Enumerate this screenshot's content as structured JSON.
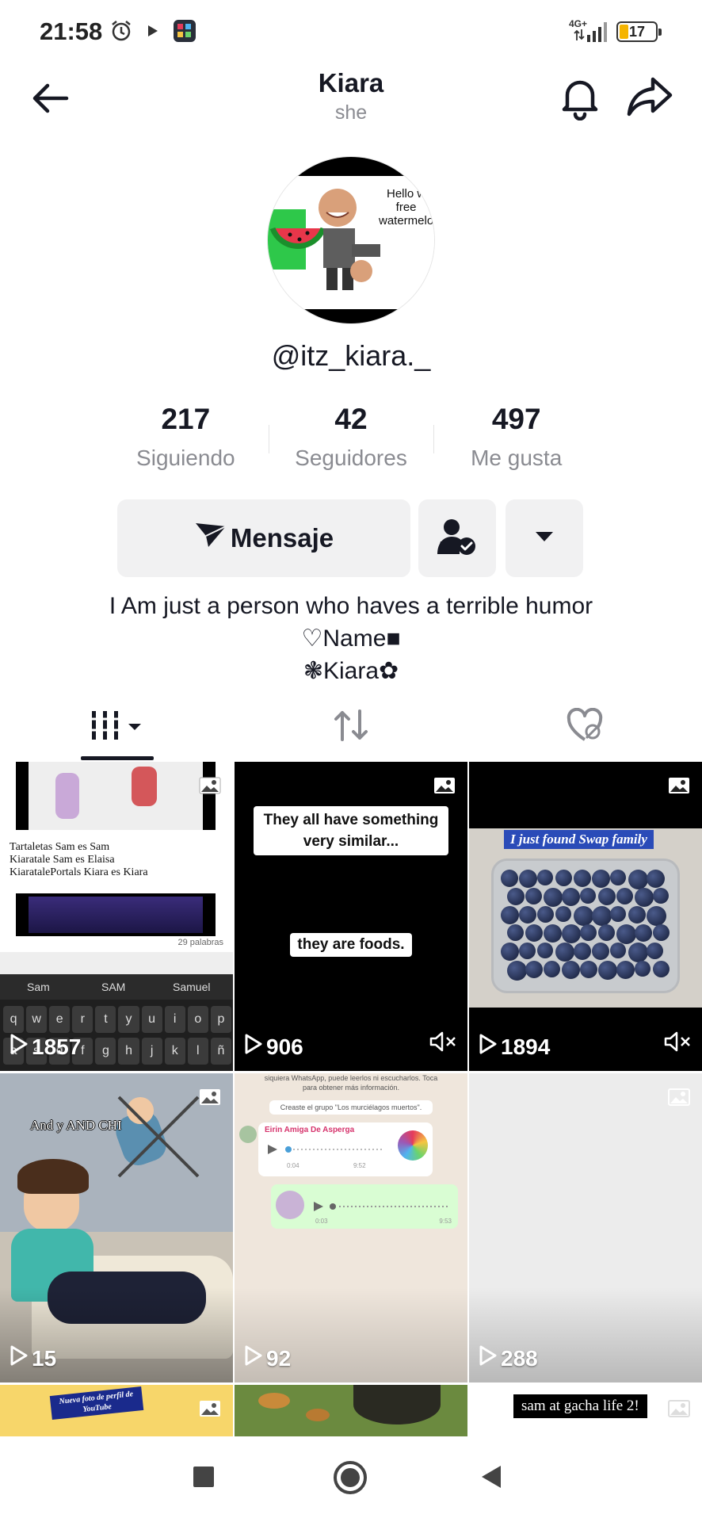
{
  "status_bar": {
    "time": "21:58",
    "network": "4G+",
    "battery": "17"
  },
  "header": {
    "name": "Kiara",
    "pronoun": "she"
  },
  "avatar": {
    "text_line1": "Hello w",
    "text_line2": "free",
    "text_line3": "watermelo"
  },
  "profile": {
    "handle": "@itz_kiara._"
  },
  "stats": [
    {
      "value": "217",
      "label": "Siguiendo"
    },
    {
      "value": "42",
      "label": "Seguidores"
    },
    {
      "value": "497",
      "label": "Me gusta"
    }
  ],
  "actions": {
    "message_label": "Mensaje"
  },
  "bio": {
    "line1": "I Am just a person who haves a terrible humor",
    "line2": "♡Name■",
    "line3": "❃Kiara✿"
  },
  "posts": [
    {
      "views": "1857",
      "doc_lines": [
        "Tartaletas Sam es Sam",
        "Kiaratale Sam es Elaisa",
        "KiaratalePortals Kiara es Kiara"
      ],
      "word_count": "29 palabras",
      "suggestions": [
        "Sam",
        "SAM",
        "Samuel"
      ],
      "keys": [
        "q",
        "w",
        "e",
        "r",
        "t",
        "y",
        "u",
        "i",
        "o",
        "p"
      ],
      "keys2": [
        "a",
        "s",
        "d",
        "f",
        "g",
        "h",
        "j",
        "k",
        "l",
        "ñ"
      ]
    },
    {
      "views": "906",
      "caption1": "They all have something very similar...",
      "caption2": "they are foods."
    },
    {
      "views": "1894",
      "caption": "I just found Swap family"
    },
    {
      "views": "15",
      "caption": "And y AND CHI"
    },
    {
      "views": "92",
      "notice": "siquiera WhatsApp, puede leerlos ni escucharlos. Toca para obtener más información.",
      "system": "Creaste el grupo \"Los murciélagos muertos\".",
      "sender": "Eirin Amiga De Asperga",
      "t1a": "0:04",
      "t1b": "9:52",
      "t2a": "0:03",
      "t2b": "9:53"
    },
    {
      "views": "288"
    },
    {
      "caption": "Nueva foto de perfil de YouTube"
    },
    {},
    {
      "caption": "sam at gacha life 2!"
    }
  ]
}
